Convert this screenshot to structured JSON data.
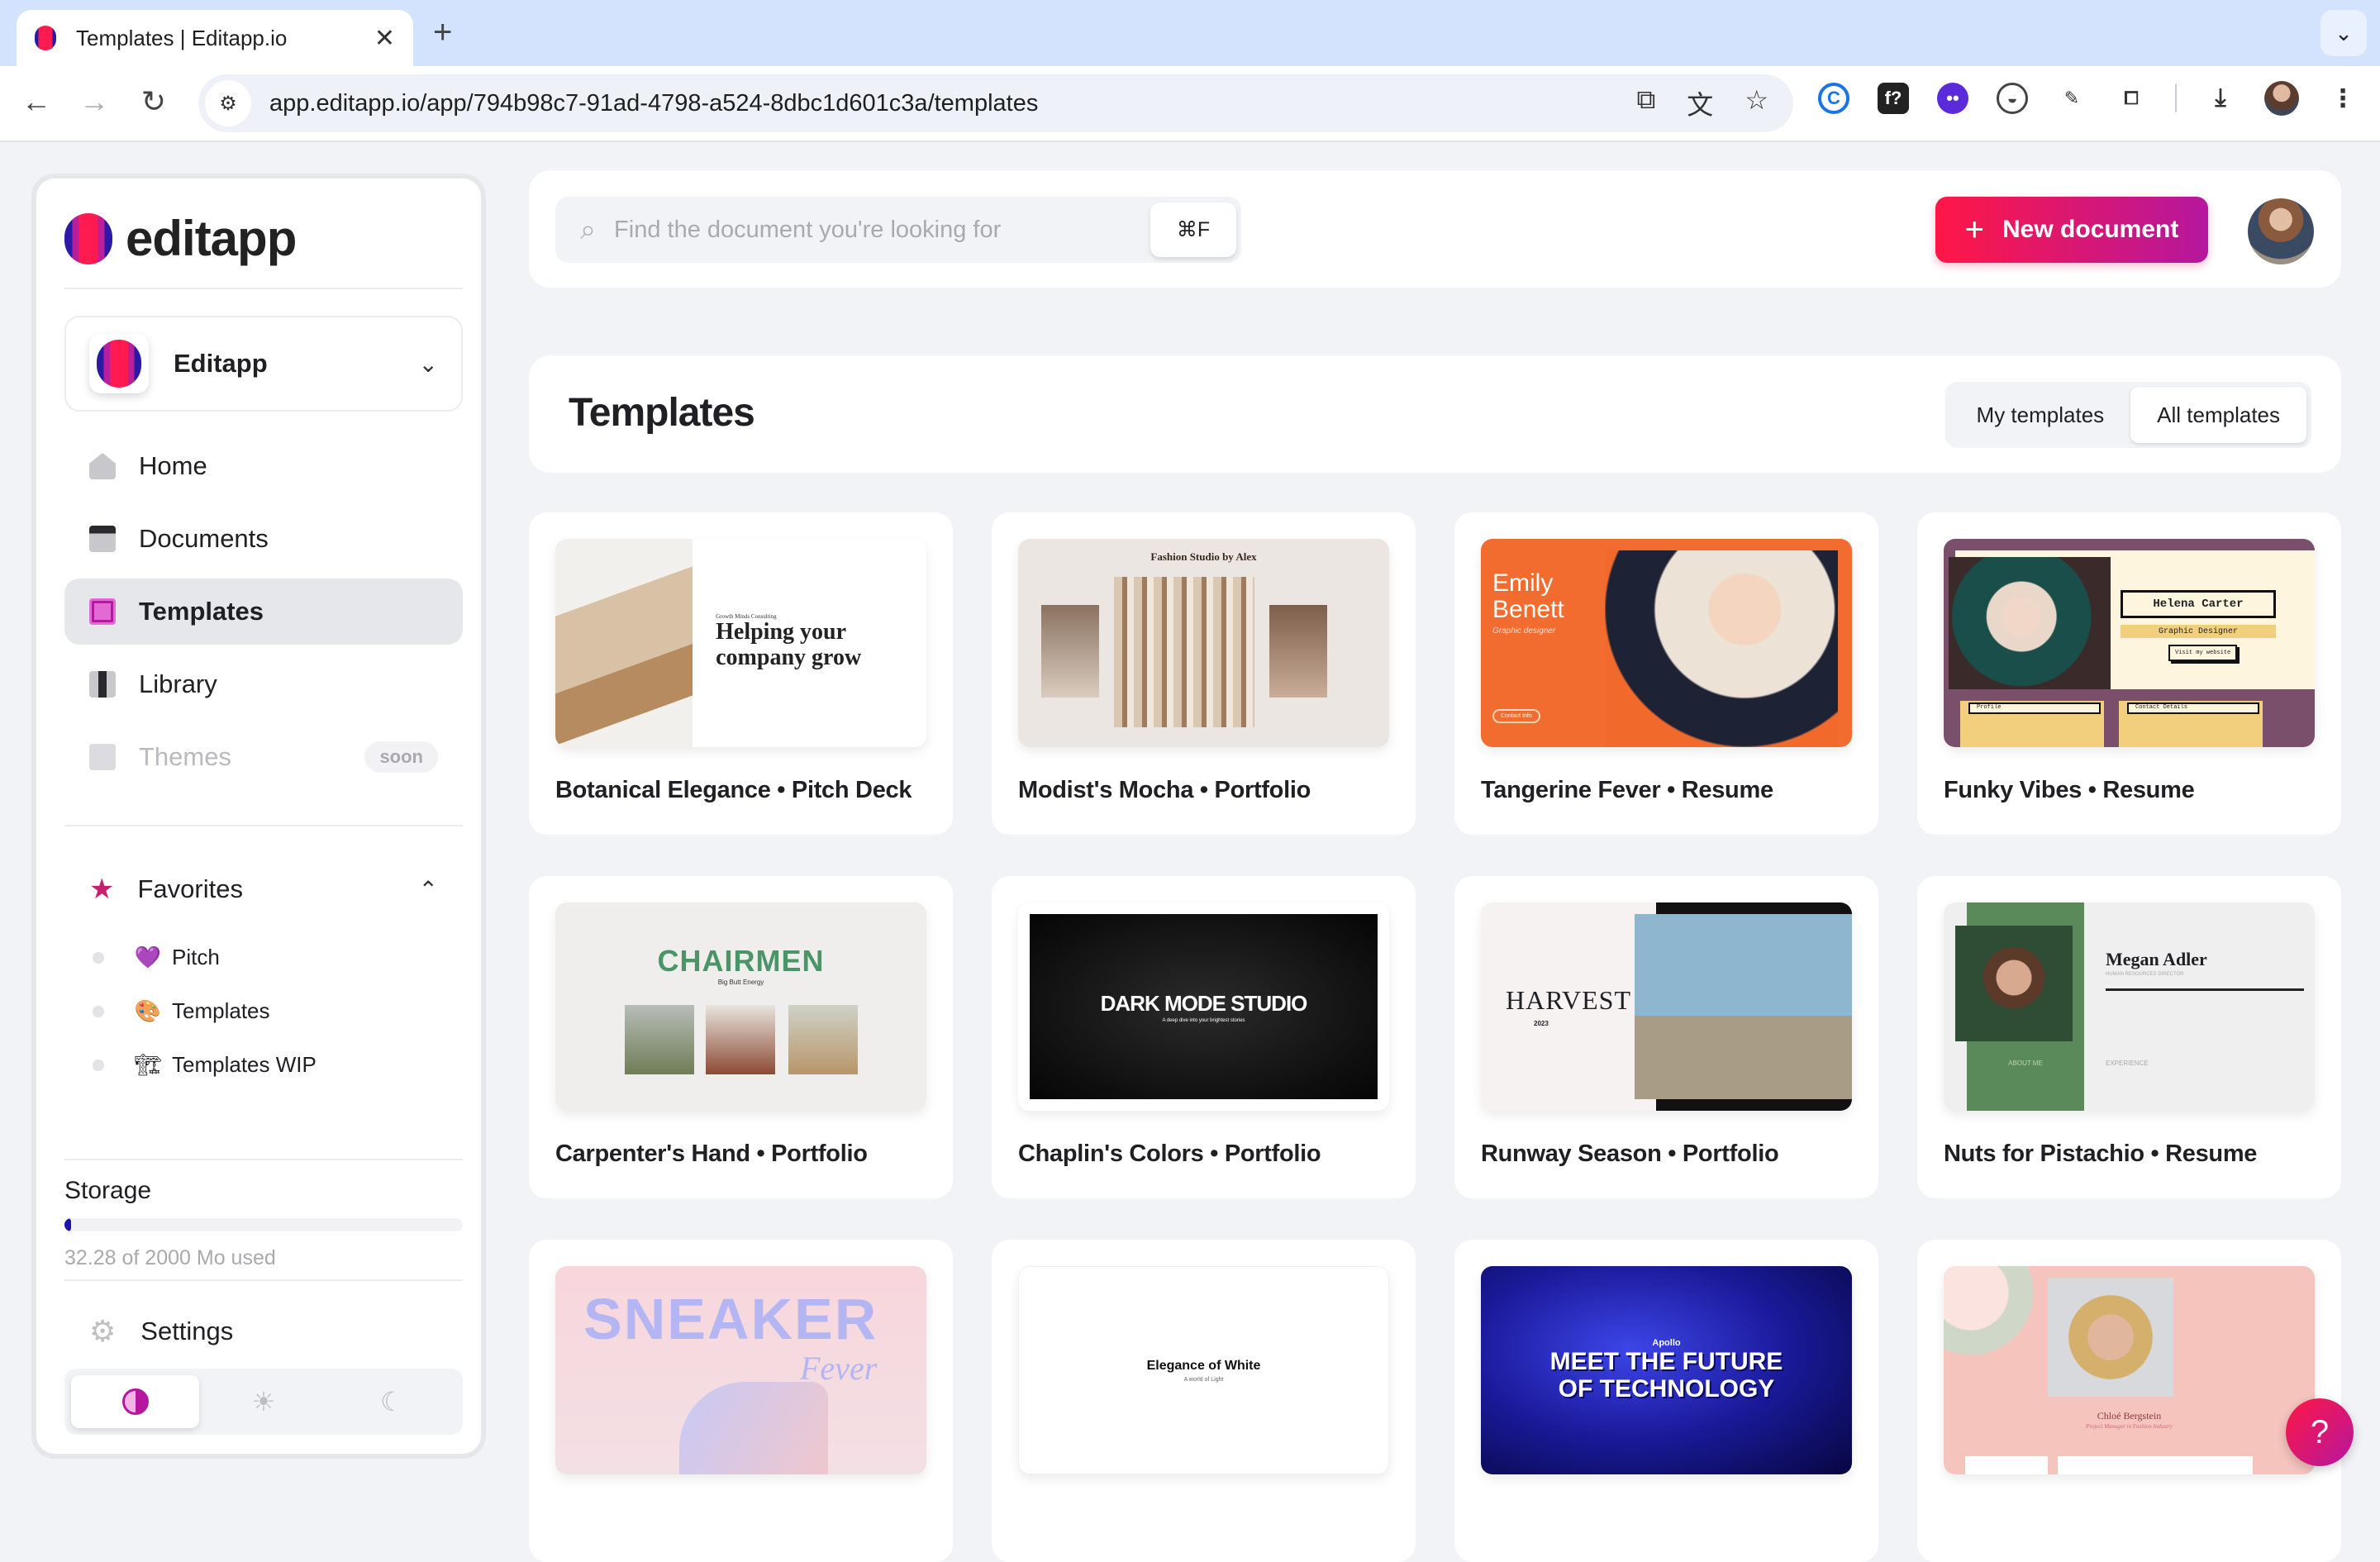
{
  "browser": {
    "tab_title": "Templates | Editapp.io",
    "url": "app.editapp.io/app/794b98c7-91ad-4798-a524-8dbc1d601c3a/templates",
    "extensions": [
      "coda-icon",
      "font-finder-icon",
      "bot-icon",
      "half-circle-icon",
      "eyedropper-icon",
      "extensions-puzzle-icon"
    ]
  },
  "sidebar": {
    "brand": "editapp",
    "workspace": "Editapp",
    "nav": [
      {
        "label": "Home",
        "icon": "home-icon"
      },
      {
        "label": "Documents",
        "icon": "folder-icon"
      },
      {
        "label": "Templates",
        "icon": "templates-icon",
        "active": true
      },
      {
        "label": "Library",
        "icon": "library-icon"
      },
      {
        "label": "Themes",
        "icon": "paint-roller-icon",
        "badge": "soon",
        "disabled": true
      }
    ],
    "favorites": {
      "label": "Favorites",
      "items": [
        {
          "emoji": "💜",
          "label": "Pitch"
        },
        {
          "emoji": "🎨",
          "label": "Templates"
        },
        {
          "emoji": "🏗",
          "label": "Templates WIP"
        }
      ]
    },
    "storage": {
      "label": "Storage",
      "used_mo": 32.28,
      "total_mo": 2000,
      "used_fraction": 0.016,
      "text": "32.28 of 2000 Mo used"
    },
    "settings_label": "Settings",
    "theme_options": [
      "auto",
      "light",
      "dark"
    ],
    "theme_selected": "auto"
  },
  "topbar": {
    "search_placeholder": "Find the document you're looking for",
    "shortcut": "⌘F",
    "new_document_label": "New document"
  },
  "templates": {
    "title": "Templates",
    "filters": [
      "My templates",
      "All templates"
    ],
    "selected_filter": "All templates",
    "items": [
      {
        "name": "Botanical Elegance • Pitch Deck",
        "thumb": {
          "kicker": "Growth Minds Consulting",
          "headline": "Helping your company grow"
        }
      },
      {
        "name": "Modist's Mocha • Portfolio",
        "thumb": {
          "headline": "Fashion Studio by Alex"
        }
      },
      {
        "name": "Tangerine Fever • Resume",
        "thumb": {
          "headline": "Emily Benett",
          "sub": "Graphic designer",
          "button": "Contact Info"
        }
      },
      {
        "name": "Funky Vibes • Resume",
        "thumb": {
          "headline": "Helena Carter",
          "sub": "Graphic Designer",
          "button": "Visit my website",
          "box1": "Profile",
          "box2": "Contact Details"
        }
      },
      {
        "name": "Carpenter's Hand • Portfolio",
        "thumb": {
          "headline": "CHAIRMEN",
          "sub": "Big Butt Energy"
        }
      },
      {
        "name": "Chaplin's Colors • Portfolio",
        "thumb": {
          "headline": "DARK MODE STUDIO",
          "sub": "A deep dive into your brightest stories"
        }
      },
      {
        "name": "Runway Season • Portfolio",
        "thumb": {
          "headline": "HARVEST",
          "sub": "2023"
        }
      },
      {
        "name": "Nuts for Pistachio • Resume",
        "thumb": {
          "headline": "Megan Adler",
          "sub": "HUMAN RESOURCES DIRECTOR",
          "about": "ABOUT ME",
          "exp": "EXPERIENCE"
        }
      },
      {
        "name": "",
        "thumb": {
          "headline": "SNEAKER",
          "sub": "Fever"
        }
      },
      {
        "name": "",
        "thumb": {
          "headline": "Elegance of White",
          "sub": "A world of Light"
        }
      },
      {
        "name": "",
        "thumb": {
          "kicker": "Apollo",
          "headline": "MEET THE FUTURE OF TECHNOLOGY"
        }
      },
      {
        "name": "",
        "thumb": {
          "headline": "Chloé Bergstein",
          "sub": "Project Manager in Fashion Industry"
        }
      }
    ]
  },
  "help_label": "?"
}
